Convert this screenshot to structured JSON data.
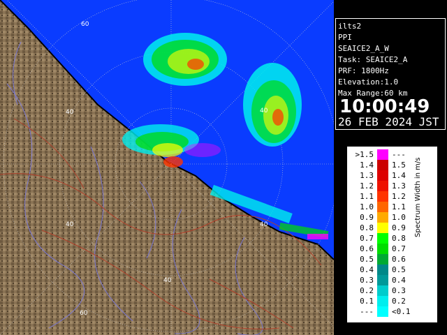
{
  "info": {
    "radar_name": "ilts2",
    "product": "PPI",
    "scan_name": "SEAICE2_A_W",
    "task": "Task: SEAICE2_A",
    "prf": "PRF: 1800Hz",
    "elevation": "Elevation:1.0",
    "max_range": "Max Range:60 km",
    "time": "10:00:49",
    "date": "26 FEB 2024 JST"
  },
  "ring_labels": [
    "40",
    "60"
  ],
  "legend": {
    "title": "Spectrum Width in m/s",
    "rows": [
      {
        "left": ">1.5",
        "right": "---",
        "color": "#ff00ff"
      },
      {
        "left": "1.4",
        "right": "1.5",
        "color": "#cc0000"
      },
      {
        "left": "1.3",
        "right": "1.4",
        "color": "#dd0000"
      },
      {
        "left": "1.2",
        "right": "1.3",
        "color": "#ee1100"
      },
      {
        "left": "1.1",
        "right": "1.2",
        "color": "#ff3300"
      },
      {
        "left": "1.0",
        "right": "1.1",
        "color": "#ff6600"
      },
      {
        "left": "0.9",
        "right": "1.0",
        "color": "#ffaa00"
      },
      {
        "left": "0.8",
        "right": "0.9",
        "color": "#ffff00"
      },
      {
        "left": "0.7",
        "right": "0.8",
        "color": "#00ff00"
      },
      {
        "left": "0.6",
        "right": "0.7",
        "color": "#00dd00"
      },
      {
        "left": "0.5",
        "right": "0.6",
        "color": "#00aa33"
      },
      {
        "left": "0.4",
        "right": "0.5",
        "color": "#008888"
      },
      {
        "left": "0.3",
        "right": "0.4",
        "color": "#009999"
      },
      {
        "left": "0.2",
        "right": "0.3",
        "color": "#00cccc"
      },
      {
        "left": "0.1",
        "right": "0.2",
        "color": "#00eeee"
      },
      {
        "left": "---",
        "right": "<0.1",
        "color": "#00ffff"
      }
    ]
  },
  "colors": {
    "sea": "#0a3cff",
    "land": "#8a7354",
    "coast": "#000000",
    "rivers": "#7a78d0",
    "roads": "#b0402a"
  }
}
